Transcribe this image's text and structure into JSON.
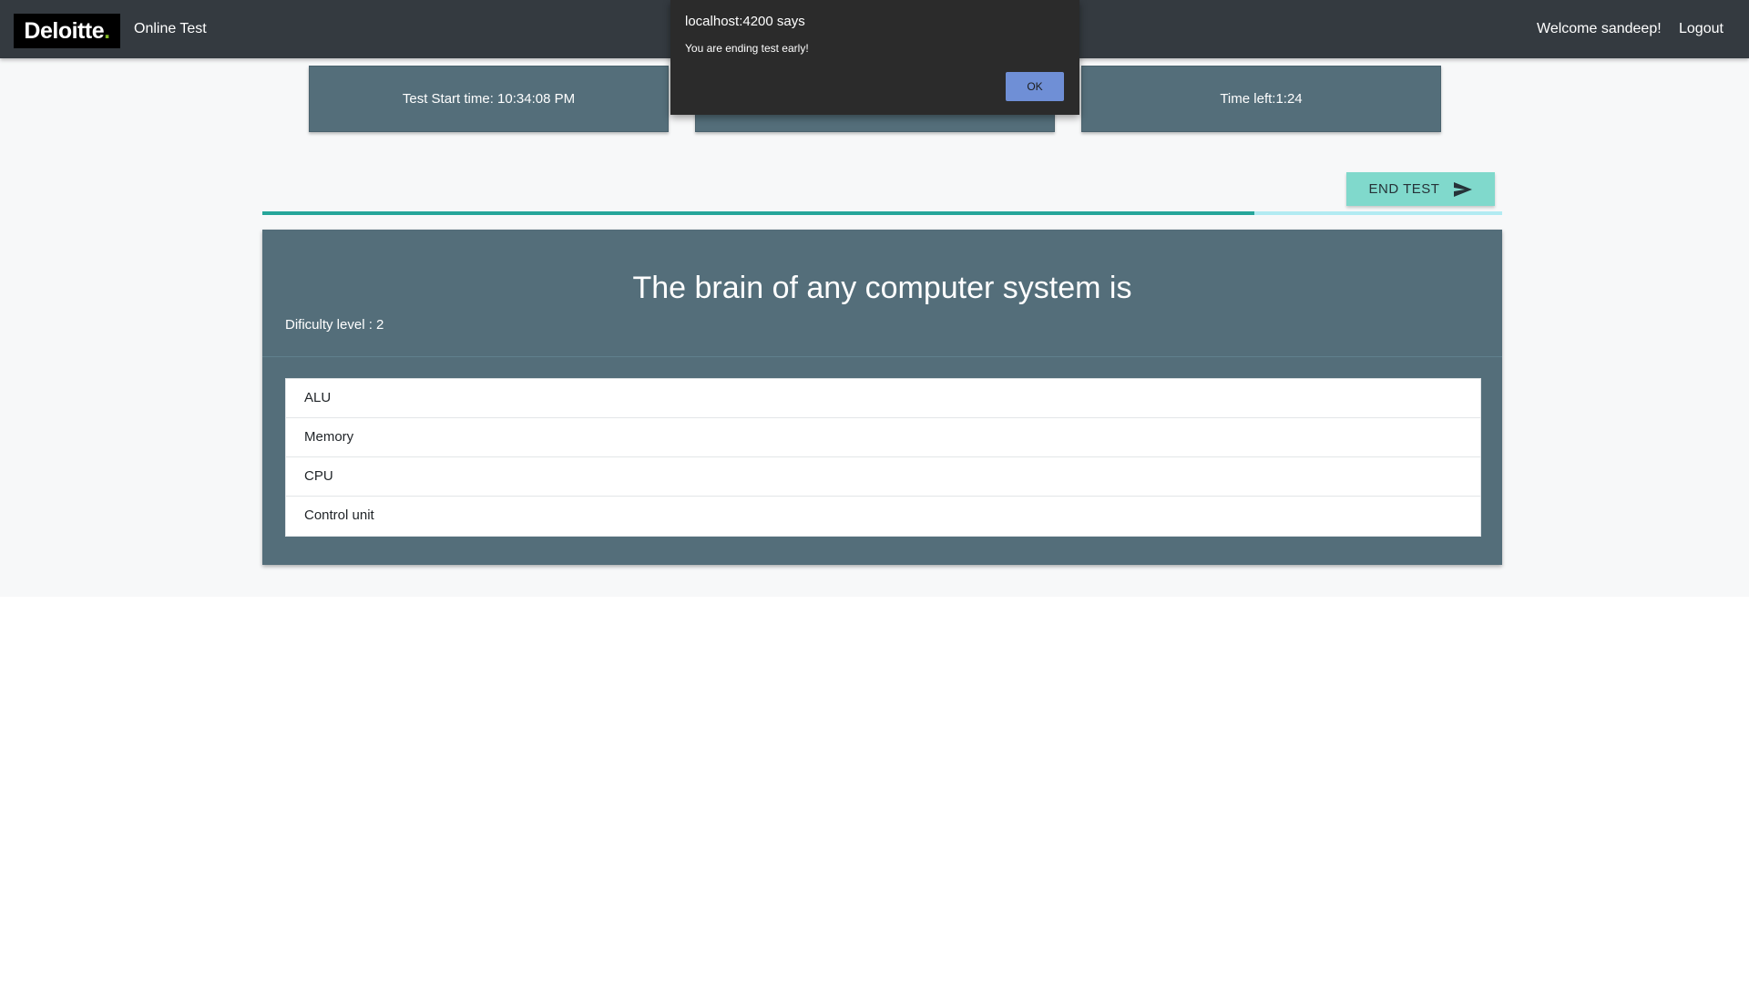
{
  "navbar": {
    "brand": "Deloitte",
    "brand_dot": ".",
    "title": "Online Test",
    "welcome": "Welcome sandeep!",
    "logout": "Logout"
  },
  "cards": {
    "start_time": "Test Start time: 10:34:08 PM",
    "middle": "",
    "time_left": "Time left:1:24"
  },
  "end_test": {
    "label": "END TEST",
    "icon": "send-icon"
  },
  "progress": {
    "fraction": 0.8
  },
  "question": {
    "text": "The brain of any computer system is",
    "difficulty": "Dificulty level : 2",
    "options": [
      "ALU",
      "Memory",
      "CPU",
      "Control unit"
    ]
  },
  "alert": {
    "title": "localhost:4200 says",
    "message": "You are ending test early!",
    "ok_label": "OK"
  },
  "colors": {
    "navbar": "#343a40",
    "card": "#546e7a",
    "accent": "#80d9cc",
    "progress": "#26a69a",
    "progress_track": "#b2ebf2",
    "brand_dot": "#86bc25",
    "ok_button": "#6f8fd6"
  }
}
